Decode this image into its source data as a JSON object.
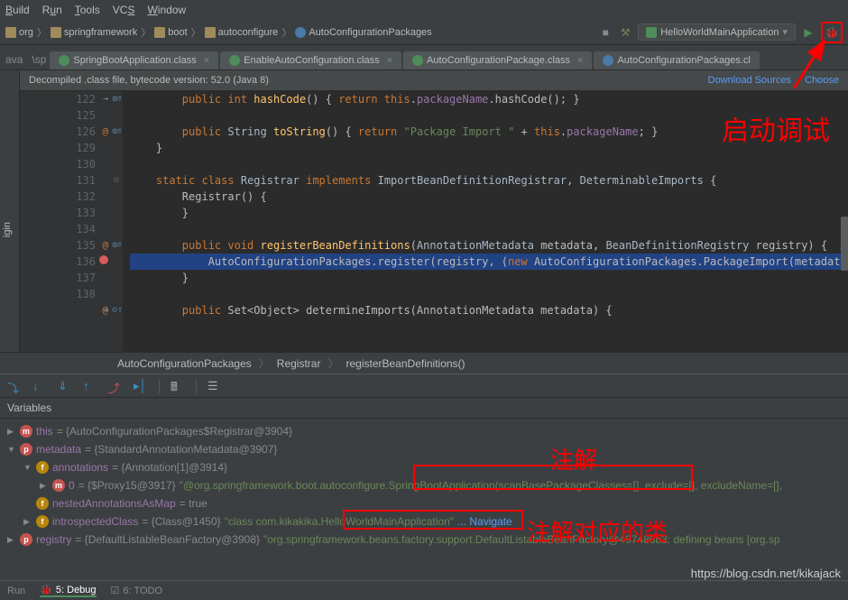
{
  "menu": {
    "items": [
      "Build",
      "Run",
      "Tools",
      "VCS",
      "Window"
    ],
    "underlines": [
      "B",
      "u",
      "T",
      "",
      "W"
    ]
  },
  "breadcrumbs": [
    "org",
    "springframework",
    "boot",
    "autoconfigure",
    "AutoConfigurationPackages"
  ],
  "runConfig": "HelloWorldMainApplication",
  "tabs": {
    "prefix": "ava",
    "pathLabel": "\\sp",
    "items": [
      {
        "label": "SpringBootApplication.class",
        "icon": "iface"
      },
      {
        "label": "EnableAutoConfiguration.class",
        "icon": "iface"
      },
      {
        "label": "AutoConfigurationPackage.class",
        "icon": "iface"
      },
      {
        "label": "AutoConfigurationPackages.cl",
        "icon": "class",
        "active": true
      }
    ]
  },
  "decompiled": {
    "msg": "Decompiled .class file, bytecode version: 52.0 (Java 8)",
    "link1": "Download Sources",
    "link2": "Choose"
  },
  "code": {
    "startLine": 122,
    "lines": [
      {
        "n": 122,
        "html": "        <span class='kw'>public int</span> <span class='fn'>hashCode</span>() { <span class='kw'>return this</span>.<span class='fld'>packageName</span>.hashCode(); }",
        "ov": true,
        "arrow": true
      },
      {
        "n": 125,
        "html": ""
      },
      {
        "n": 126,
        "html": "        <span class='kw'>public</span> <span class='type'>String</span> <span class='fn'>toString</span>() { <span class='kw'>return</span> <span class='str'>\"Package Import \"</span> + <span class='kw'>this</span>.<span class='fld'>packageName</span>; }",
        "ov": true,
        "at": true
      },
      {
        "n": 129,
        "html": "    }"
      },
      {
        "n": 130,
        "html": ""
      },
      {
        "n": 131,
        "html": "    <span class='kw'>static class</span> <span class='type'>Registrar</span> <span class='kw'>implements</span> <span class='type'>ImportBeanDefinitionRegistrar</span>, <span class='type'>DeterminableImports</span> {"
      },
      {
        "n": 132,
        "html": "        Registrar() {"
      },
      {
        "n": 133,
        "html": "        }"
      },
      {
        "n": 134,
        "html": ""
      },
      {
        "n": 135,
        "html": "        <span class='kw'>public void</span> <span class='fn'>registerBeanDefinitions</span>(<span class='type'>AnnotationMetadata</span> metadata, <span class='type'>BeanDefinitionRegistry</span> registry) {  <span class='cmt'>metadata: StandardAnnotationMe</span>",
        "ov": true,
        "at": true
      },
      {
        "n": 136,
        "html": "            AutoConfigurationPackages.register(registry, (<span class='kw'>new</span> AutoConfigurationPackages.PackageImport(metadata)).getPackageName());  <span class='cmt'>regist</span>",
        "bp": true,
        "hl": true
      },
      {
        "n": 137,
        "html": "        }"
      },
      {
        "n": 138,
        "html": ""
      },
      {
        "n": "",
        "html": "        <span class='kw'>public</span> Set&lt;Object&gt; determineImports(AnnotationMetadata metadata) {",
        "ov": true,
        "at": true,
        "arrow": true
      }
    ]
  },
  "crumbBar": [
    "AutoConfigurationPackages",
    "Registrar",
    "registerBeanDefinitions()"
  ],
  "vars": {
    "title": "Variables",
    "rows": [
      {
        "indent": 0,
        "exp": "▶",
        "badge": "m",
        "name": "this",
        "val": " = {AutoConfigurationPackages$Registrar@3904}"
      },
      {
        "indent": 0,
        "exp": "▼",
        "badge": "p",
        "name": "metadata",
        "val": " = {StandardAnnotationMetadata@3907}"
      },
      {
        "indent": 1,
        "exp": "▼",
        "badge": "f",
        "name": "annotations",
        "val": " = {Annotation[1]@3914}"
      },
      {
        "indent": 2,
        "exp": "▶",
        "badge": "m",
        "name": "0",
        "val": " = {$Proxy15@3917} ",
        "str": "\"@org.springframework.boot.autoconfigure.SpringBootApplication(scanBasePackageClasses=[], exclude=[], excludeName=[], "
      },
      {
        "indent": 1,
        "exp": "",
        "badge": "f",
        "name": "nestedAnnotationsAsMap",
        "val": " = true"
      },
      {
        "indent": 1,
        "exp": "▶",
        "badge": "f",
        "name": "introspectedClass",
        "val": " = {Class@1450} ",
        "str": "\"class com.kikakika.HelloWorldMainApplication\"",
        "nav": "... Navigate"
      },
      {
        "indent": 0,
        "exp": "▶",
        "badge": "p",
        "name": "registry",
        "val": " = {DefaultListableBeanFactory@3908} ",
        "str": "\"org.springframework.beans.factory.support.DefaultListableBeanFactory@497486b3: defining beans [org.sp"
      }
    ]
  },
  "bottomTabs": {
    "run": "Run",
    "debug": "5: Debug",
    "todo": "6: TODO"
  },
  "watermark": "https://blog.csdn.net/kikajack",
  "annotations": {
    "debug": "启动调试",
    "anno": "注解",
    "clazz": "注解对应的类"
  },
  "sideLabel": "igin"
}
